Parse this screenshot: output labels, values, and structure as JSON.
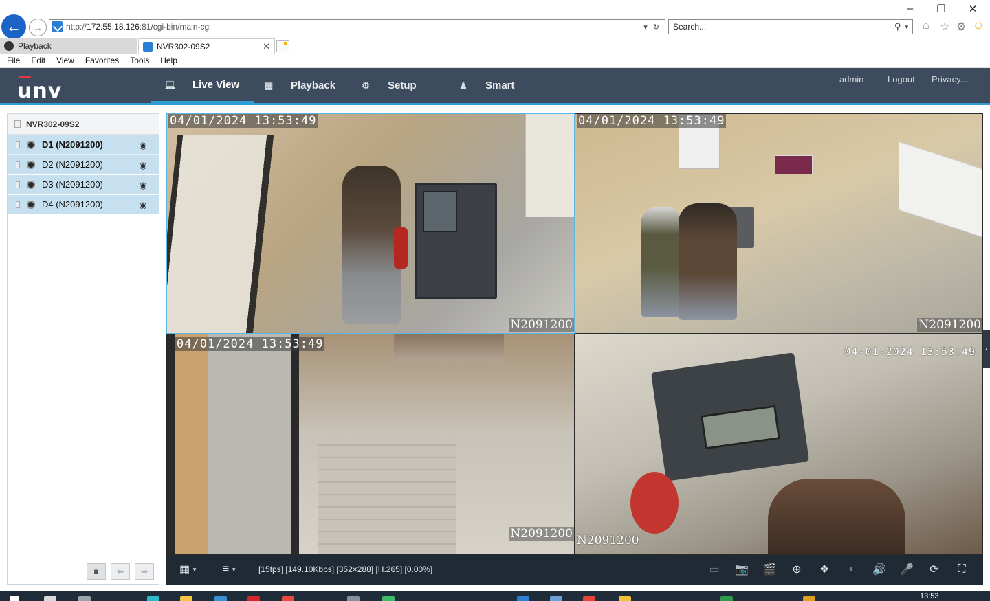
{
  "browser": {
    "url_prefix": "http://",
    "url_host": "172.55.18.126",
    "url_rest": ":81/cgi-bin/main-cgi",
    "search_placeholder": "Search...",
    "tabs": [
      {
        "label": "Playback"
      },
      {
        "label": "NVR302-09S2"
      }
    ],
    "menu": [
      "File",
      "Edit",
      "View",
      "Favorites",
      "Tools",
      "Help"
    ]
  },
  "app": {
    "logo": "unv",
    "nav": [
      {
        "label": "Live View"
      },
      {
        "label": "Playback"
      },
      {
        "label": "Setup"
      },
      {
        "label": "Smart"
      }
    ],
    "user": "admin",
    "logout": "Logout",
    "privacy": "Privacy..."
  },
  "sidebar": {
    "device": "NVR302-09S2",
    "channels": [
      {
        "label": "D1 (N2091200)"
      },
      {
        "label": "D2 (N2091200)"
      },
      {
        "label": "D3 (N2091200)"
      },
      {
        "label": "D4 (N2091200)"
      }
    ]
  },
  "tiles": [
    {
      "timestamp": "04/01/2024 13:53:49",
      "camera_id": "N2091200"
    },
    {
      "timestamp": "04/01/2024 13:53:49",
      "camera_id": "N2091200"
    },
    {
      "timestamp": "04/01/2024 13:53:49",
      "camera_id": "N2091200"
    },
    {
      "timestamp": "04-01-2024 13:53:49",
      "camera_id": "N2091200"
    }
  ],
  "toolbar": {
    "stream_info": "[15fps] [149.10Kbps] [352×288] [H.265] [0.00%]"
  },
  "taskbar": {
    "clock": "13:53"
  }
}
